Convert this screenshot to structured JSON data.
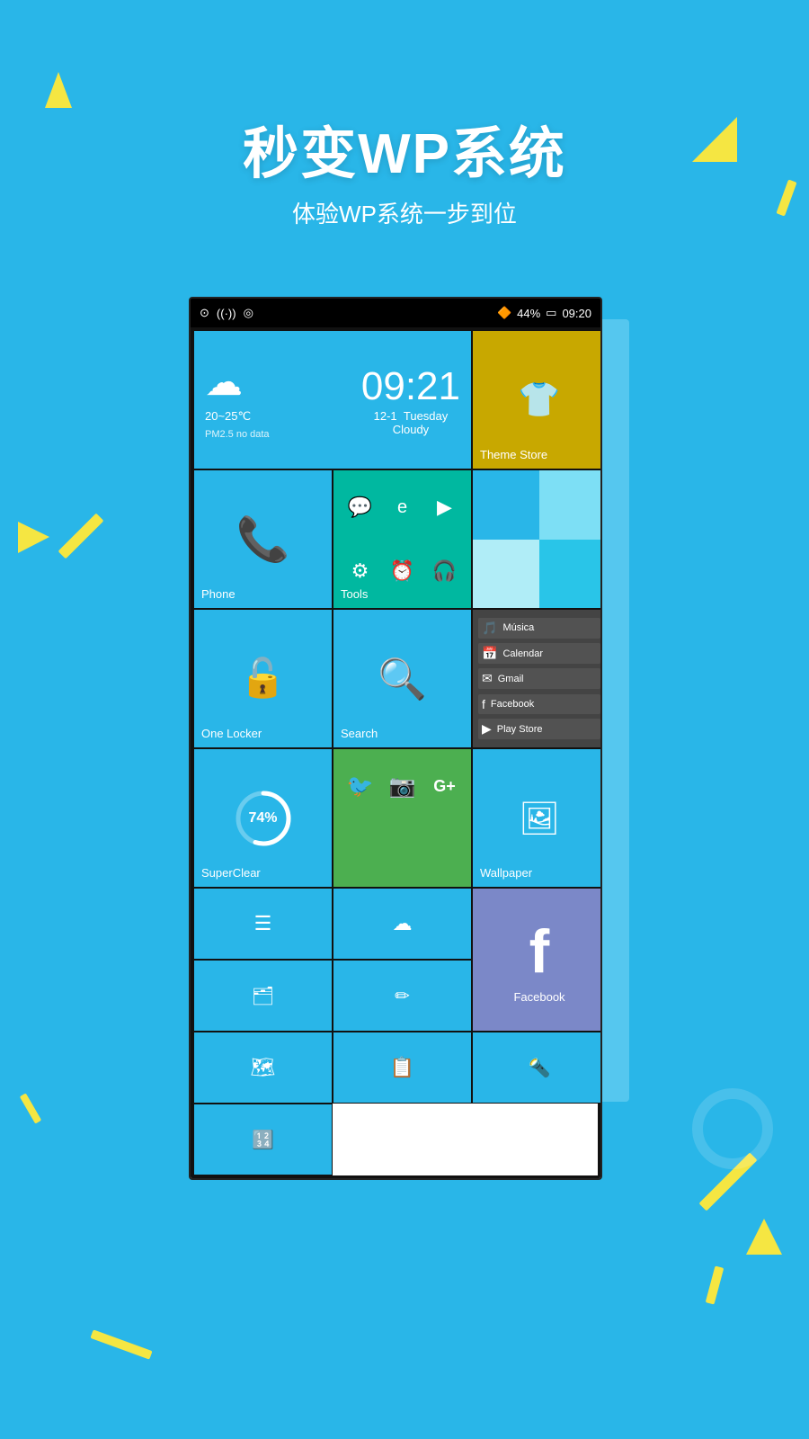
{
  "page": {
    "bg_color": "#29b6e8",
    "title_main": "秒变WP系统",
    "title_sub": "体验WP系统一步到位"
  },
  "phone": {
    "status_bar": {
      "battery": "44%",
      "time": "09:20"
    },
    "weather_tile": {
      "time": "09:21",
      "date": "12-1",
      "day": "Tuesday",
      "temp": "20~25℃",
      "pm": "PM2.5  no data",
      "condition": "Cloudy"
    },
    "tiles": {
      "theme_store": "Theme Store",
      "phone": "Phone",
      "tools": "Tools",
      "one_locker": "One Locker",
      "search": "Search",
      "superclear": "SuperClear",
      "superclear_pct": "74%",
      "wallpaper": "Wallpaper",
      "facebook": "Facebook",
      "social_icons": [
        "🐦",
        "📷",
        "G+"
      ]
    },
    "apps": [
      {
        "name": "Música",
        "icon": "🎵"
      },
      {
        "name": "Calendar",
        "icon": "📅"
      },
      {
        "name": "Gmail",
        "icon": "✉"
      },
      {
        "name": "Facebook",
        "icon": "f"
      },
      {
        "name": "Play Store",
        "icon": "▶"
      }
    ]
  }
}
